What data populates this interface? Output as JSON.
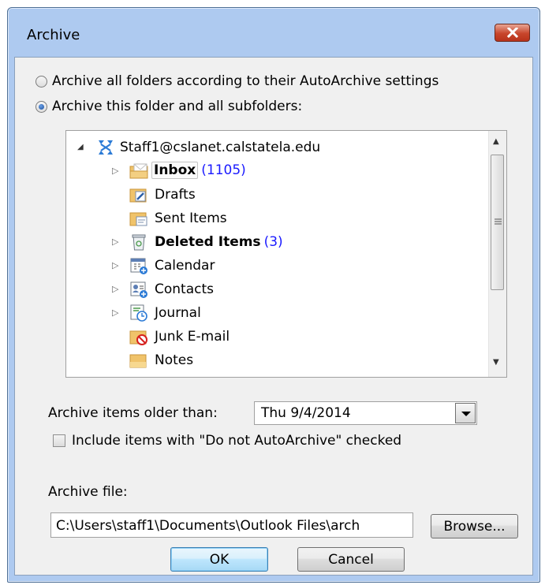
{
  "window": {
    "title": "Archive"
  },
  "options": {
    "archive_all_label": "Archive all folders according to their AutoArchive settings",
    "archive_this_label": "Archive this folder and all subfolders:",
    "selected": "archive_this"
  },
  "tree": {
    "root": {
      "label": "Staff1@cslanet.calstatela.edu",
      "expanded": true,
      "icon": "exchange-account-icon"
    },
    "items": [
      {
        "label": "Inbox",
        "count": "(1105)",
        "bold": true,
        "selected": true,
        "expandable": true,
        "icon": "inbox-folder-icon"
      },
      {
        "label": "Drafts",
        "count": "",
        "bold": false,
        "selected": false,
        "expandable": false,
        "icon": "drafts-folder-icon"
      },
      {
        "label": "Sent Items",
        "count": "",
        "bold": false,
        "selected": false,
        "expandable": false,
        "icon": "sent-items-folder-icon"
      },
      {
        "label": "Deleted Items",
        "count": "(3)",
        "bold": true,
        "selected": false,
        "expandable": true,
        "icon": "deleted-items-icon"
      },
      {
        "label": "Calendar",
        "count": "",
        "bold": false,
        "selected": false,
        "expandable": true,
        "icon": "calendar-icon"
      },
      {
        "label": "Contacts",
        "count": "",
        "bold": false,
        "selected": false,
        "expandable": true,
        "icon": "contacts-icon"
      },
      {
        "label": "Journal",
        "count": "",
        "bold": false,
        "selected": false,
        "expandable": true,
        "icon": "journal-icon"
      },
      {
        "label": "Junk E-mail",
        "count": "",
        "bold": false,
        "selected": false,
        "expandable": false,
        "icon": "junk-email-icon"
      },
      {
        "label": "Notes",
        "count": "",
        "bold": false,
        "selected": false,
        "expandable": false,
        "icon": "notes-icon"
      }
    ]
  },
  "older_than": {
    "label": "Archive items older than:",
    "value": "Thu 9/4/2014"
  },
  "include_checkbox": {
    "label": "Include items with \"Do not AutoArchive\" checked",
    "checked": false
  },
  "archive_file": {
    "label": "Archive file:",
    "value": "C:\\Users\\staff1\\Documents\\Outlook Files\\arch"
  },
  "buttons": {
    "browse": "Browse...",
    "ok": "OK",
    "cancel": "Cancel"
  },
  "colors": {
    "count_blue": "#1a1aff",
    "titlebar": "#aecaf0",
    "close_red": "#c8462c",
    "dialog_bg": "#f0f0f0"
  }
}
